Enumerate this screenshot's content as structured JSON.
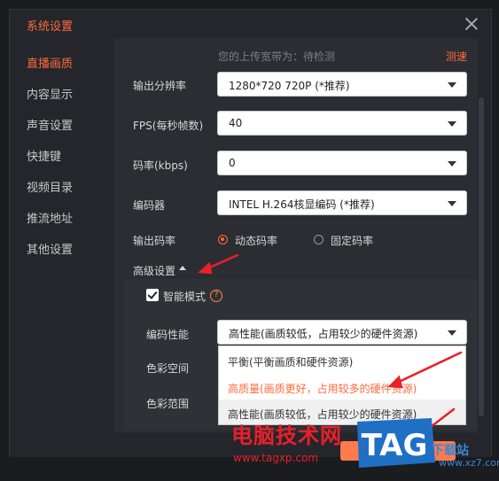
{
  "window": {
    "title": "系统设置"
  },
  "sidebar": {
    "items": [
      {
        "label": "直播画质",
        "active": true
      },
      {
        "label": "内容显示"
      },
      {
        "label": "声音设置"
      },
      {
        "label": "快捷键"
      },
      {
        "label": "视频目录"
      },
      {
        "label": "推流地址"
      },
      {
        "label": "其他设置"
      }
    ]
  },
  "upload": {
    "text": "您的上传宽带为：待检测",
    "test_link": "测速"
  },
  "settings": {
    "resolution": {
      "label": "输出分辨率",
      "value": "1280*720 720P (*推荐)"
    },
    "fps": {
      "label": "FPS(每秒帧数)",
      "value": "40"
    },
    "bitrate": {
      "label": "码率(kbps)",
      "value": "0"
    },
    "encoder": {
      "label": "编码器",
      "value": "INTEL H.264核显编码 (*推荐)"
    },
    "rate_mode": {
      "label": "输出码率",
      "dynamic": "动态码率",
      "fixed": "固定码率"
    }
  },
  "advanced": {
    "label": "高级设置",
    "smart_mode": "智能模式",
    "help": "?",
    "encode_perf": {
      "label": "编码性能",
      "value": "高性能(画质较低，占用较少的硬件资源)"
    },
    "color_space": "色彩空间",
    "color_range": "色彩范围",
    "options": [
      "平衡(平衡画质和硬件资源)",
      "高质量(画质更好，占用较多的硬件资源)",
      "高性能(画质较低，占用较少的硬件资源)"
    ]
  },
  "watermark": {
    "brand": "电脑技术网",
    "url": "www.tagxp.com",
    "logo": "TAG",
    "site": "下载站",
    "site_url": "www.xz7.com"
  },
  "colors": {
    "accent": "#ff6a3d",
    "arrow": "#e8202a",
    "bg": "#24262b"
  }
}
